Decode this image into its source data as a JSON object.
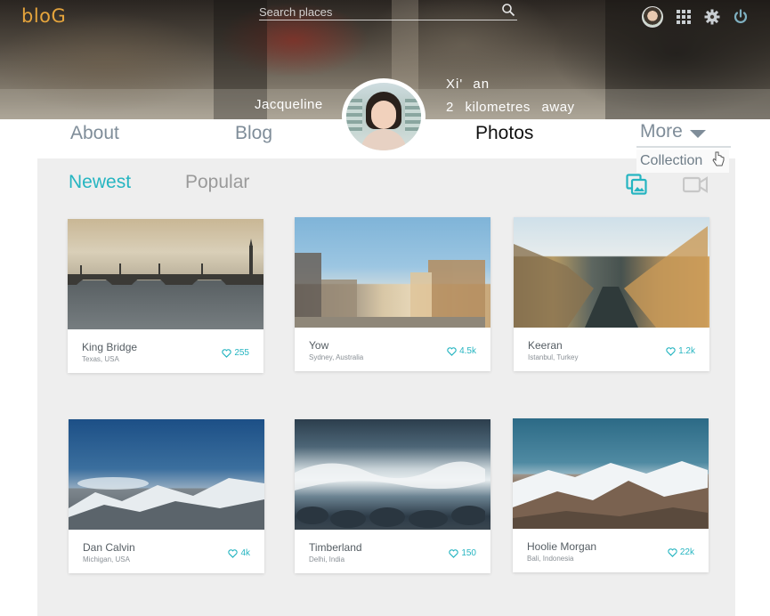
{
  "header": {
    "brand": "bloG",
    "search_placeholder": "Search places"
  },
  "profile": {
    "name": "Jacqueline",
    "city": "Xi' an",
    "distance": "2 kilometres away"
  },
  "nav": {
    "items": [
      {
        "label": "About"
      },
      {
        "label": "Blog"
      },
      {
        "label": "Photos",
        "active": true
      },
      {
        "label": "More"
      }
    ],
    "dropdown": [
      "Collection"
    ]
  },
  "tabs": [
    {
      "label": "Newest",
      "active": true
    },
    {
      "label": "Popular"
    }
  ],
  "icons": {
    "photo_view": "photo-gallery-icon",
    "video_view": "video-camera-icon",
    "apps": "grid-icon",
    "settings": "gear-icon",
    "power": "power-icon"
  },
  "colors": {
    "accent": "#26b5c1",
    "brand": "#e5a43c",
    "panel": "#eeeeee"
  },
  "cards": [
    {
      "title": "King Bridge",
      "location": "Texas, USA",
      "likes": "255"
    },
    {
      "title": "Yow",
      "location": "Sydney, Australia",
      "likes": "4.5k"
    },
    {
      "title": "Keeran",
      "location": "Istanbul, Turkey",
      "likes": "1.2k"
    },
    {
      "title": "Dan Calvin",
      "location": "Michigan, USA",
      "likes": "4k"
    },
    {
      "title": "Timberland",
      "location": "Delhi, India",
      "likes": "150"
    },
    {
      "title": "Hoolie Morgan",
      "location": "Bali, Indonesia",
      "likes": "22k"
    }
  ]
}
